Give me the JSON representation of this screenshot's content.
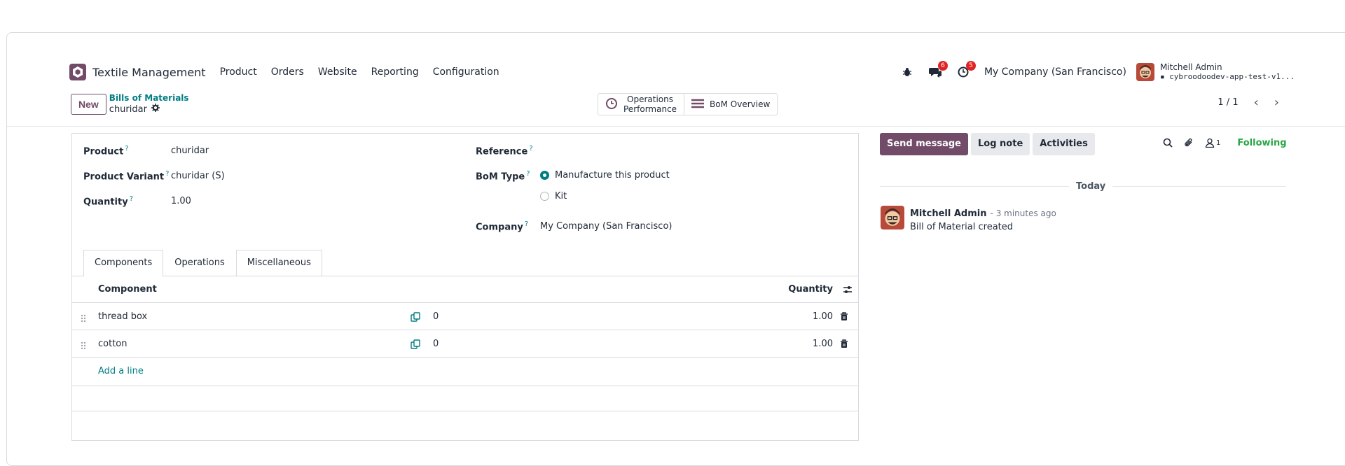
{
  "navbar": {
    "app_name": "Textile Management",
    "menu": [
      "Product",
      "Orders",
      "Website",
      "Reporting",
      "Configuration"
    ],
    "messages_badge": "6",
    "activities_badge": "5",
    "company": "My Company (San Francisco)",
    "user_name": "Mitchell Admin",
    "user_db": "cybroodoodev-app-test-v1..."
  },
  "control": {
    "new_label": "New",
    "breadcrumb_parent": "Bills of Materials",
    "breadcrumb_current": "churidar"
  },
  "smart_buttons": {
    "operations_line1": "Operations",
    "operations_line2": "Performance",
    "bom_overview": "BoM Overview"
  },
  "pager": {
    "value": "1 / 1"
  },
  "form": {
    "product_label": "Product",
    "product_value": "churidar",
    "variant_label": "Product Variant",
    "variant_value": "churidar (S)",
    "quantity_label": "Quantity",
    "quantity_value": "1.00",
    "reference_label": "Reference",
    "bom_type_label": "BoM Type",
    "bom_type_options": [
      "Manufacture this product",
      "Kit"
    ],
    "bom_type_selected": "Manufacture this product",
    "company_label": "Company",
    "company_value": "My Company (San Francisco)",
    "help_mark": "?"
  },
  "tabs": [
    "Components",
    "Operations",
    "Miscellaneous"
  ],
  "components_table": {
    "headers": {
      "component": "Component",
      "quantity": "Quantity"
    },
    "rows": [
      {
        "component": "thread box",
        "forecast": "0",
        "quantity": "1.00"
      },
      {
        "component": "cotton",
        "forecast": "0",
        "quantity": "1.00"
      }
    ],
    "add_line": "Add a line"
  },
  "chatter": {
    "send_message": "Send message",
    "log_note": "Log note",
    "activities": "Activities",
    "followers_count": "1",
    "following": "Following",
    "today": "Today",
    "message": {
      "author": "Mitchell Admin",
      "time": "- 3 minutes ago",
      "body": "Bill of Material created"
    }
  },
  "colors": {
    "brand": "#714b67",
    "link": "#017e84",
    "following": "#28a745",
    "badge": "#e02424"
  }
}
